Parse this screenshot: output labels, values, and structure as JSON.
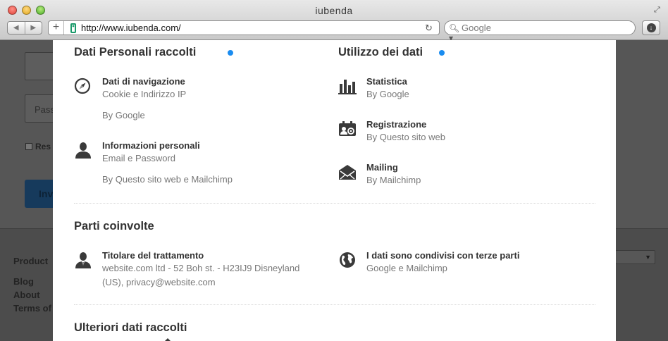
{
  "browser": {
    "title": "iubenda",
    "url": "http://www.iubenda.com/",
    "search_placeholder": "Google"
  },
  "background": {
    "field_placeholder": "Pass",
    "checkbox_label": "Res",
    "button_label": "Inv",
    "footer_title": "Product",
    "footer_links": [
      "Blog",
      "About",
      "Terms of"
    ]
  },
  "modal": {
    "dati_raccolti": {
      "title": "Dati Personali raccolti",
      "items": [
        {
          "icon": "compass-icon",
          "title": "Dati di navigazione",
          "line1": "Cookie e Indirizzo IP",
          "by": "By Google"
        },
        {
          "icon": "person-icon",
          "title": "Informazioni personali",
          "line1": "Email e Password",
          "by": "By Questo sito web e Mailchimp"
        }
      ]
    },
    "utilizzo": {
      "title": "Utilizzo dei dati",
      "items": [
        {
          "icon": "bar-chart-icon",
          "title": "Statistica",
          "line1": "By Google"
        },
        {
          "icon": "registration-icon",
          "title": "Registrazione",
          "line1": "By Questo sito web"
        },
        {
          "icon": "envelope-icon",
          "title": "Mailing",
          "line1": "By Mailchimp"
        }
      ]
    },
    "parti": {
      "title": "Parti coinvolte",
      "titolare": {
        "icon": "person-suit-icon",
        "title": "Titolare del trattamento",
        "line1": "website.com ltd - 52 Boh st. - H23IJ9 Disneyland",
        "line2": "(US), privacy@website.com"
      },
      "condivisi": {
        "icon": "globe-icon",
        "title": "I dati sono condivisi con terze parti",
        "line1": "Google e Mailchimp"
      }
    },
    "ulteriori": {
      "title": "Ulteriori dati raccolti"
    },
    "accent_color": "#1a8cf0"
  }
}
